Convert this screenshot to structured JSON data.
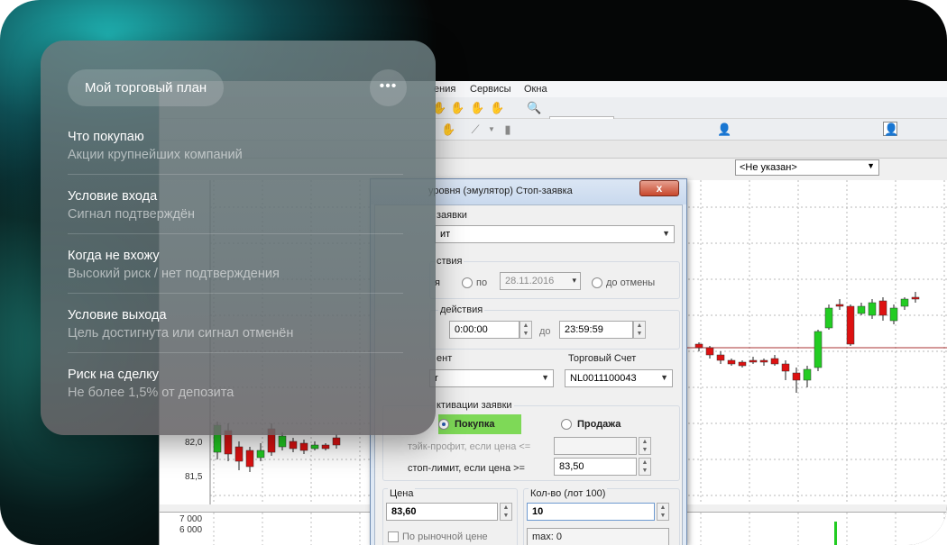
{
  "terminal": {
    "menu": [
      "ения",
      "Сервисы",
      "Окна"
    ],
    "client_select": "<Не указан>",
    "price_levels": [
      "82,0",
      "81,5"
    ],
    "volume_levels": [
      "7 000",
      "6 000"
    ]
  },
  "dialog": {
    "title": "уровня (эмулятор) Стоп-заявка",
    "close": "x",
    "order_type_group": "заявки",
    "order_type_value": "ит",
    "validity_group": "ствия",
    "validity_opt_partial": "я",
    "validity_opt_until": "по",
    "validity_date": "28.11.2016",
    "validity_opt_cancel": "до отмены",
    "time_group": "действия",
    "time_from": "0:00:00",
    "time_to_label": "до",
    "time_to": "23:59:59",
    "instrument_group": "ент",
    "instrument_value": "r",
    "account_group": "Торговый Счет",
    "account_value": "NL0011100043",
    "activation_group": "ктивации заявки",
    "buy_label": "Покупка",
    "sell_label": "Продажа",
    "take_profit_label": "тэйк-профит, если цена <=",
    "stop_limit_label": "стоп-лимит, если цена >=",
    "stop_limit_value": "83,50",
    "price_label": "Цена",
    "price_value": "83,60",
    "qty_label": "Кол-во (лот 100)",
    "qty_value": "10",
    "market_price_label": "По рыночной цене",
    "max_label": "max: 0"
  },
  "plan": {
    "title": "Мой торговый план",
    "more": "•••",
    "items": [
      {
        "title": "Что покупаю",
        "subtitle": "Акции крупнейших компаний"
      },
      {
        "title": "Условие входа",
        "subtitle": "Сигнал подтверждён"
      },
      {
        "title": "Когда не вхожу",
        "subtitle": "Высокий риск / нет подтверждения"
      },
      {
        "title": "Условие выхода",
        "subtitle": "Цель достигнута или сигнал отменён"
      },
      {
        "title": "Риск на сделку",
        "subtitle": "Не более 1,5% от депозита"
      }
    ]
  },
  "colors": {
    "candle_up": "#22cc22",
    "candle_down": "#dd1111",
    "buy_highlight": "#7ed957",
    "panel_bg": "#5c6a6e"
  }
}
